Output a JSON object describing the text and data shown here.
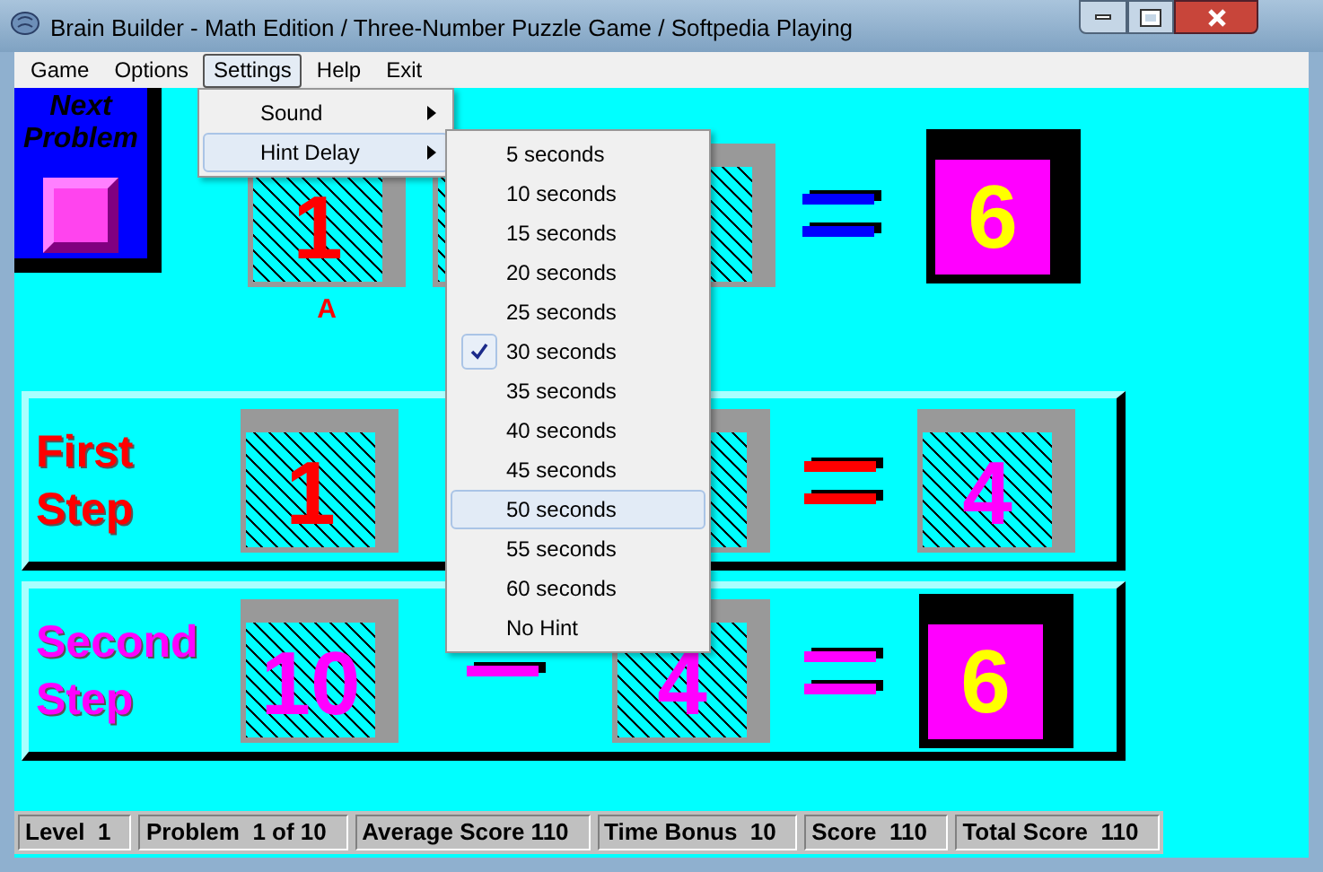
{
  "window": {
    "title": "Brain Builder - Math Edition / Three-Number Puzzle Game / Softpedia Playing"
  },
  "menu_bar": [
    {
      "label": "Game",
      "selected": false
    },
    {
      "label": "Options",
      "selected": false
    },
    {
      "label": "Settings",
      "selected": true
    },
    {
      "label": "Help",
      "selected": false
    },
    {
      "label": "Exit",
      "selected": false
    }
  ],
  "settings_menu": [
    {
      "label": "Sound",
      "selected": false
    },
    {
      "label": "Hint Delay",
      "selected": true
    }
  ],
  "hint_delay_menu": [
    {
      "label": "5 seconds",
      "checked": false,
      "selected": false
    },
    {
      "label": "10 seconds",
      "checked": false,
      "selected": false
    },
    {
      "label": "15 seconds",
      "checked": false,
      "selected": false
    },
    {
      "label": "20 seconds",
      "checked": false,
      "selected": false
    },
    {
      "label": "25 seconds",
      "checked": false,
      "selected": false
    },
    {
      "label": "30 seconds",
      "checked": true,
      "selected": false
    },
    {
      "label": "35 seconds",
      "checked": false,
      "selected": false
    },
    {
      "label": "40 seconds",
      "checked": false,
      "selected": false
    },
    {
      "label": "45 seconds",
      "checked": false,
      "selected": false
    },
    {
      "label": "50 seconds",
      "checked": false,
      "selected": true
    },
    {
      "label": "55 seconds",
      "checked": false,
      "selected": false
    },
    {
      "label": "60 seconds",
      "checked": false,
      "selected": false
    },
    {
      "label": "No Hint",
      "checked": false,
      "selected": false
    }
  ],
  "next_problem": {
    "label": "Next Problem"
  },
  "puzzle": {
    "items": [
      {
        "kind": "cube",
        "text": "1",
        "color": "#ff0000",
        "caption": "A"
      },
      {
        "kind": "cube"
      },
      {
        "kind": "cube"
      },
      {
        "kind": "equals",
        "color": "#0000ff"
      },
      {
        "kind": "answer",
        "text": "6"
      }
    ]
  },
  "steps": [
    {
      "label": "First Step",
      "color": "#ff0000",
      "items": [
        {
          "kind": "cube",
          "text": "1",
          "color": "#ff0000"
        },
        {
          "kind": "hidden"
        },
        {
          "kind": "cube"
        },
        {
          "kind": "equals",
          "color": "#ff0000"
        },
        {
          "kind": "cube",
          "text": "4",
          "color": "#ff00ff"
        }
      ]
    },
    {
      "label": "Second Step",
      "color": "#ff00ff",
      "items": [
        {
          "kind": "cube",
          "text": "10",
          "color": "#ff00ff"
        },
        {
          "kind": "minus",
          "color": "#ff00ff"
        },
        {
          "kind": "cube",
          "text": "4",
          "color": "#ff00ff"
        },
        {
          "kind": "equals",
          "color": "#ff00ff"
        },
        {
          "kind": "answer",
          "text": "6"
        }
      ]
    }
  ],
  "status_bar": [
    "Level  1",
    "Problem  1 of 10",
    "Average Score 110",
    "Time Bonus  10",
    "Score  110",
    "Total Score  110"
  ]
}
